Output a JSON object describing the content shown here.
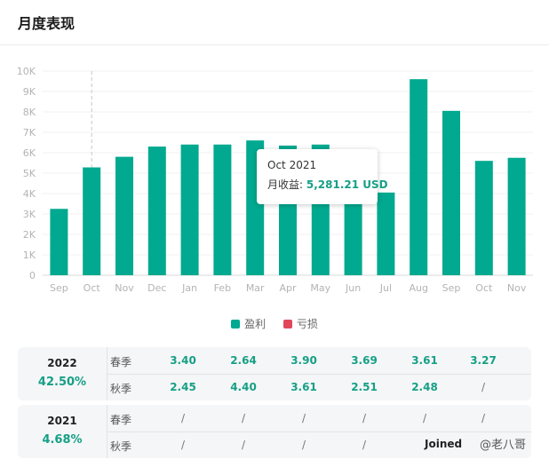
{
  "header": {
    "title": "月度表现"
  },
  "chart_data": {
    "type": "bar",
    "categories": [
      "Sep",
      "Oct",
      "Nov",
      "Dec",
      "Jan",
      "Feb",
      "Mar",
      "Apr",
      "May",
      "Jun",
      "Jul",
      "Aug",
      "Sep",
      "Oct",
      "Nov"
    ],
    "series": [
      {
        "name": "盈利",
        "values": [
          3250,
          5281.21,
          5800,
          6300,
          6400,
          6400,
          6600,
          6350,
          6400,
          4700,
          4050,
          9600,
          8050,
          5600,
          5750
        ],
        "color": "#00a98f"
      }
    ],
    "ylim": [
      0,
      10000
    ],
    "yticks": [
      "0",
      "1K",
      "2K",
      "3K",
      "4K",
      "5K",
      "6K",
      "7K",
      "8K",
      "9K",
      "10K"
    ],
    "highlight_index": 1,
    "grid": true
  },
  "tooltip": {
    "month": "Oct 2021",
    "label": "月收益: ",
    "value": "5,281.21 USD"
  },
  "legend": [
    {
      "label": "盈利",
      "color": "#00a98f"
    },
    {
      "label": "亏损",
      "color": "#e0455a"
    }
  ],
  "years": [
    {
      "year": "2022",
      "pct": "42.50%",
      "rows": [
        {
          "label": "春季",
          "values": [
            "3.40",
            "2.64",
            "3.90",
            "3.69",
            "3.61",
            "3.27"
          ]
        },
        {
          "label": "秋季",
          "values": [
            "2.45",
            "4.40",
            "3.61",
            "2.51",
            "2.48",
            "/"
          ]
        }
      ]
    },
    {
      "year": "2021",
      "pct": "4.68%",
      "rows": [
        {
          "label": "春季",
          "values": [
            "/",
            "/",
            "/",
            "/",
            "/",
            "/"
          ]
        },
        {
          "label": "秋季",
          "values": [
            "/",
            "/",
            "/",
            "/",
            "",
            ""
          ]
        }
      ],
      "joined": "Joined",
      "watermark": "@老八哥"
    }
  ]
}
